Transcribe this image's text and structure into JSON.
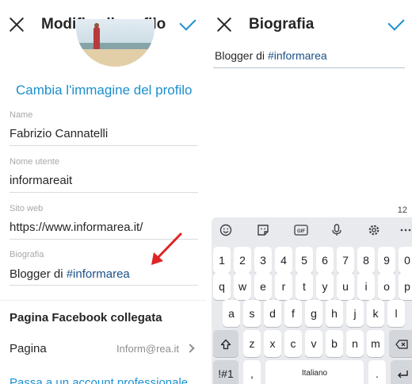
{
  "edit_profile": {
    "title": "Modifica il profilo",
    "change_photo": "Cambia l'immagine del profilo",
    "fields": {
      "name_label": "Name",
      "name_value": "Fabrizio Cannatelli",
      "username_label": "Nome utente",
      "username_value": "informareait",
      "website_label": "Sito web",
      "website_value": "https://www.informarea.it/",
      "bio_label": "Biografia",
      "bio_prefix": "Blogger di ",
      "bio_hashtag": "#informarea"
    },
    "facebook_section": "Pagina Facebook collegata",
    "page_label": "Pagina",
    "page_value": "Inform@rea.it",
    "pro_link": "Passa a un account professionale"
  },
  "bio_editor": {
    "title": "Biografia",
    "text_prefix": "Blogger di ",
    "text_hashtag": "#informarea",
    "counter": "12"
  },
  "keyboard": {
    "toolbar_icons": [
      "emoji-icon",
      "sticker-icon",
      "gif-icon",
      "mic-icon",
      "settings-icon",
      "more-icon"
    ],
    "gif_label": "GIF",
    "row_numbers": [
      "1",
      "2",
      "3",
      "4",
      "5",
      "6",
      "7",
      "8",
      "9",
      "0"
    ],
    "row_1": [
      "q",
      "w",
      "e",
      "r",
      "t",
      "y",
      "u",
      "i",
      "o",
      "p"
    ],
    "row_2": [
      "a",
      "s",
      "d",
      "f",
      "g",
      "h",
      "j",
      "k",
      "l"
    ],
    "row_3": [
      "z",
      "x",
      "c",
      "v",
      "b",
      "n",
      "m"
    ],
    "symbols_key": "!#1",
    "comma_key": ",",
    "space_label": "Italiano",
    "period_key": "."
  },
  "colors": {
    "accent": "#1a8fd0",
    "hashtag": "#1a4f88",
    "arrow": "#e02424"
  }
}
